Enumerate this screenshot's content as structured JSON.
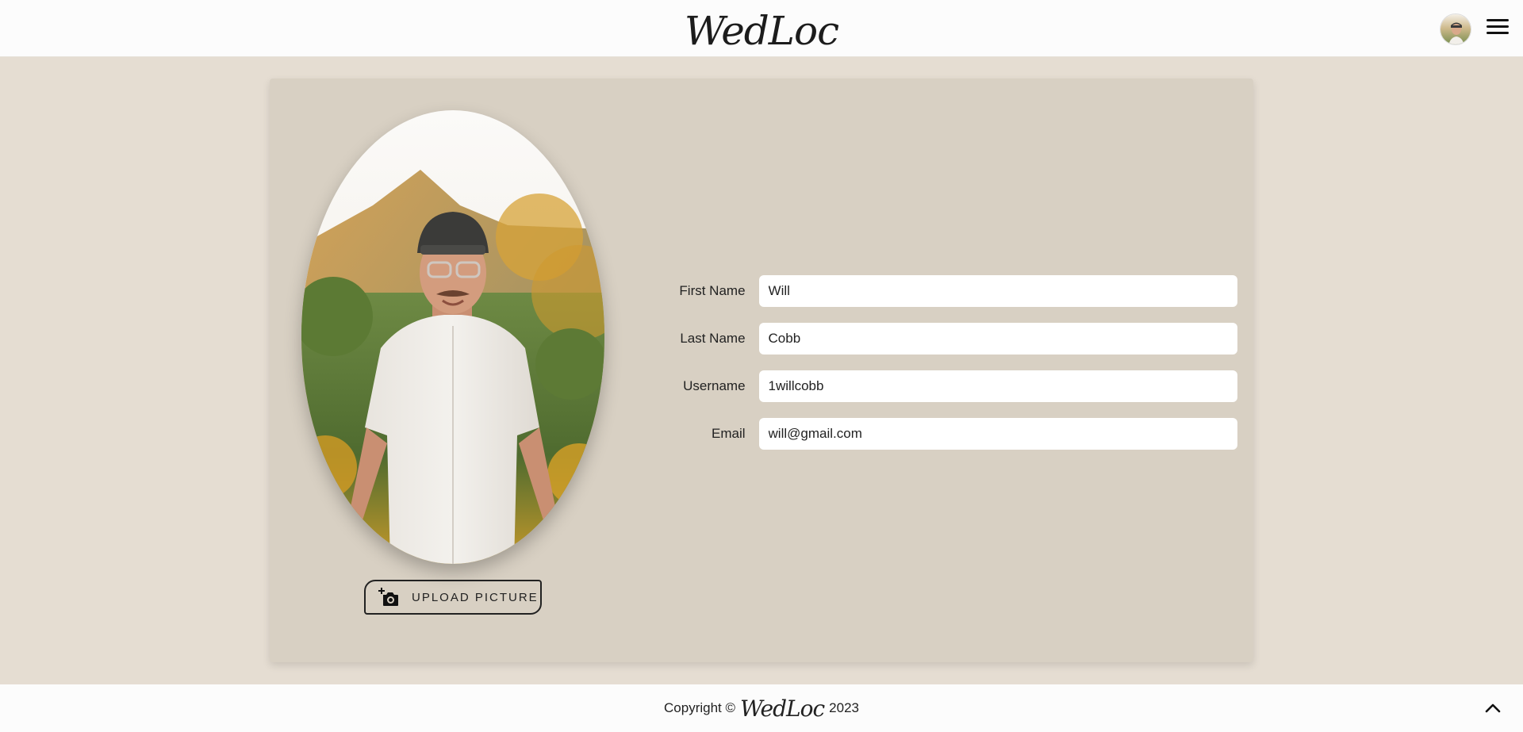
{
  "header": {
    "brand": "WedLoc",
    "avatar_icon": "user-avatar-icon",
    "menu_icon": "hamburger-menu-icon"
  },
  "profile": {
    "upload_label": "UPLOAD PICTURE",
    "upload_icon": "add-photo-camera-icon",
    "fields": {
      "first_name": {
        "label": "First Name",
        "value": "Will"
      },
      "last_name": {
        "label": "Last Name",
        "value": "Cobb"
      },
      "username": {
        "label": "Username",
        "value": "1willcobb"
      },
      "email": {
        "label": "Email",
        "value": "will@gmail.com"
      }
    }
  },
  "footer": {
    "copyright": "Copyright ©",
    "brand": "WedLoc",
    "year": "2023",
    "scroll_icon": "chevron-up-icon"
  },
  "colors": {
    "page_bg": "#e5ddd2",
    "card_bg": "#d8d0c3",
    "bar_bg": "#fcfcfc"
  }
}
